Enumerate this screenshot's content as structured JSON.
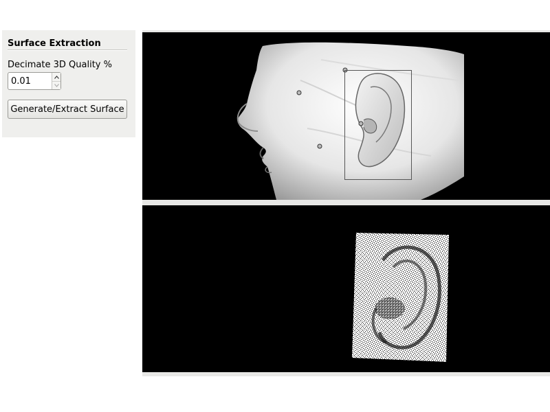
{
  "panel": {
    "title": "Surface Extraction",
    "decimate_label": "Decimate 3D Quality %",
    "decimate_value": "0.01",
    "generate_button": "Generate/Extract Surface"
  },
  "views": {
    "top": {
      "content": "3D head surface with ear selection box",
      "background": "#000000"
    },
    "bottom": {
      "content": "Extracted ear point cloud",
      "background": "#000000"
    }
  },
  "icons": {
    "spin_up": "chevron-up-icon",
    "spin_down": "chevron-down-icon"
  }
}
